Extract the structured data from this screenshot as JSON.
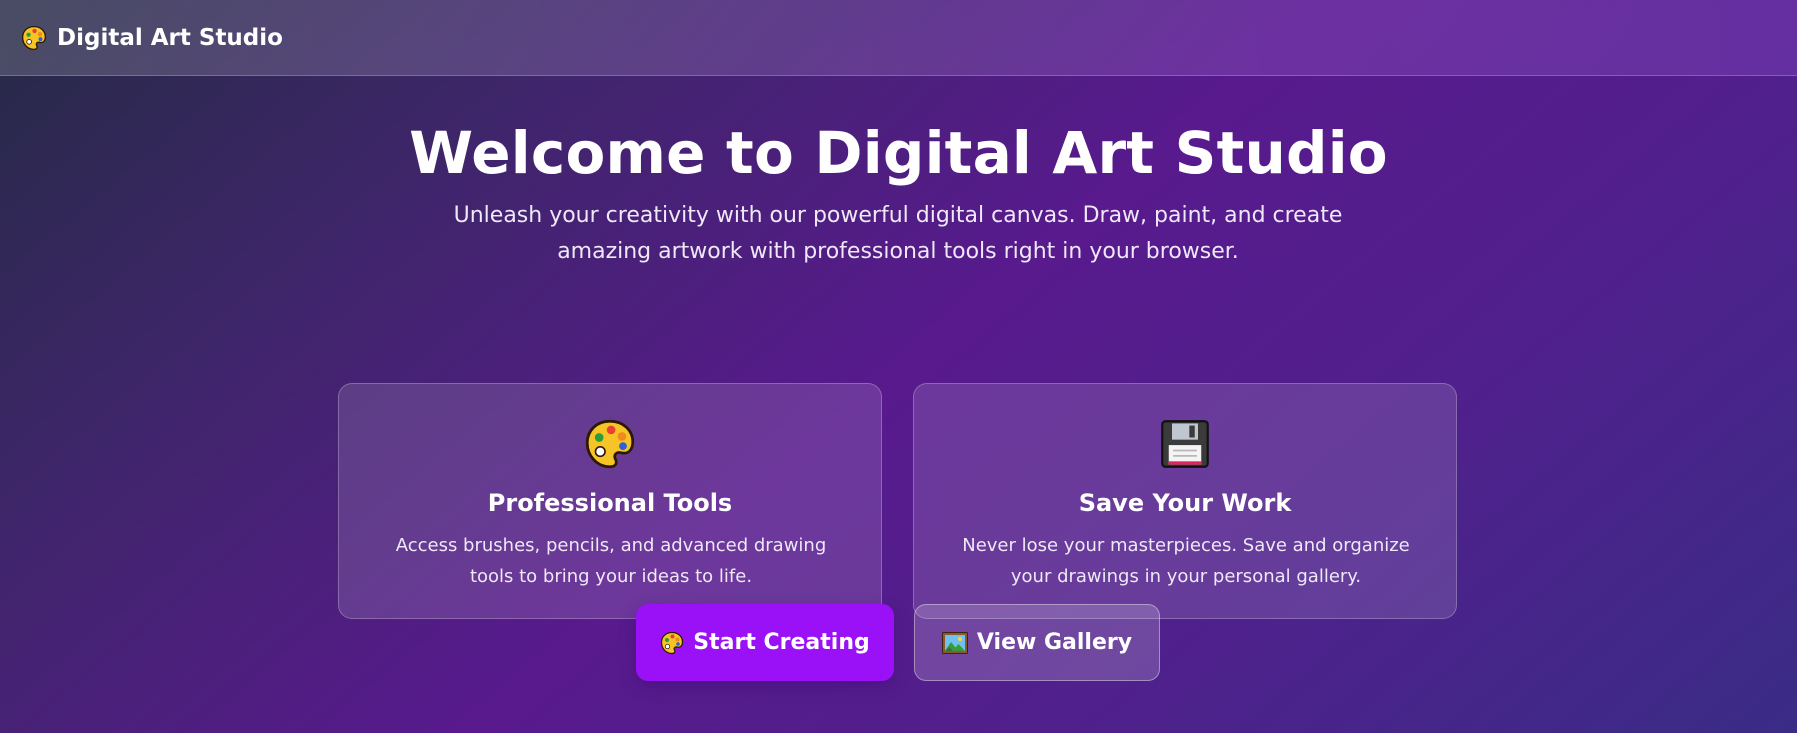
{
  "navbar": {
    "brand_icon": "palette-icon",
    "brand_name": "Digital Art Studio"
  },
  "hero": {
    "title": "Welcome to Digital Art Studio",
    "subtitle": "Unleash your creativity with our powerful digital canvas. Draw, paint, and create amazing artwork with professional tools right in your browser."
  },
  "features": [
    {
      "icon": "palette-icon",
      "title": "Professional Tools",
      "description": "Access brushes, pencils, and advanced drawing tools to bring your ideas to life."
    },
    {
      "icon": "floppy-disk-icon",
      "title": "Save Your Work",
      "description": "Never lose your masterpieces. Save and organize your drawings in your personal gallery."
    }
  ],
  "actions": {
    "start_label": "Start Creating",
    "start_icon": "palette-icon",
    "gallery_label": "View Gallery",
    "gallery_icon": "framed-picture-icon"
  },
  "colors": {
    "primary_button": "#9a10f7",
    "accent_purple": "#581a8d"
  }
}
